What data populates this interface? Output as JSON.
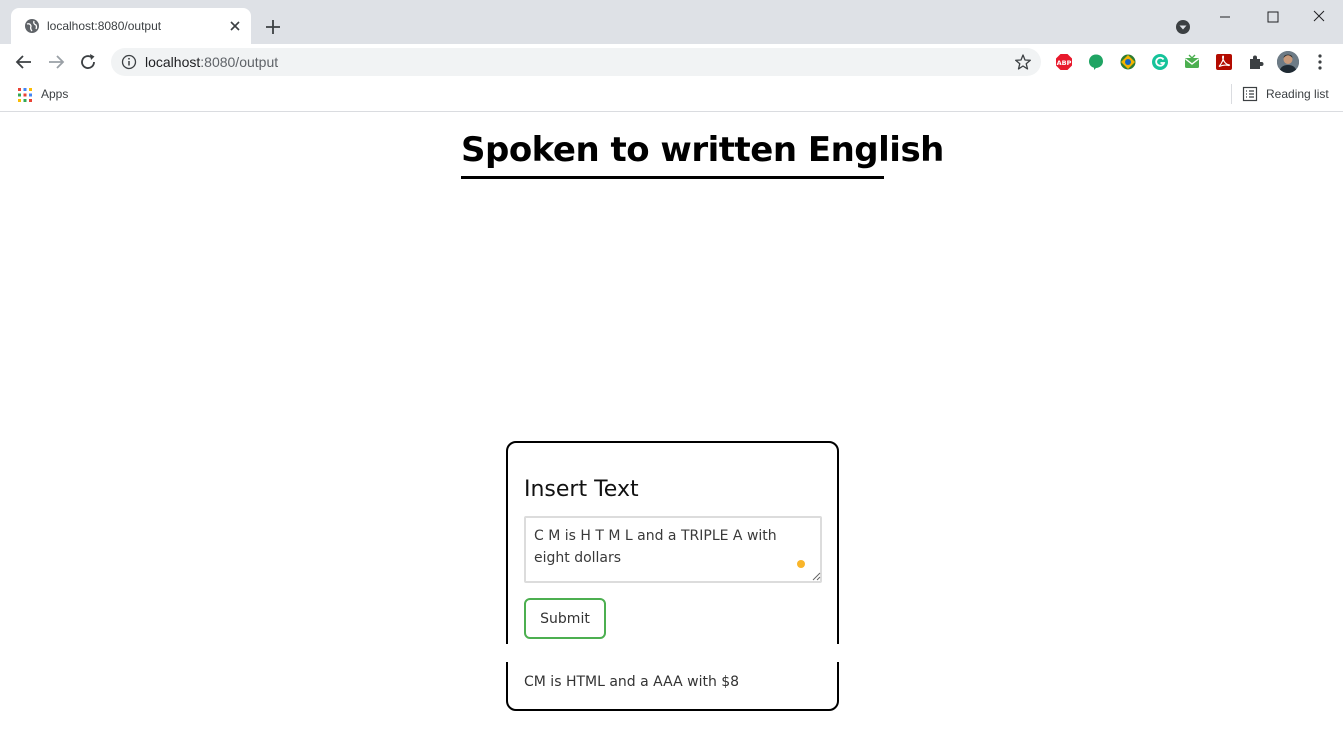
{
  "browser": {
    "tab_title": "localhost:8080/output",
    "url_host": "localhost",
    "url_path": ":8080/output",
    "bookmarks": {
      "apps_label": "Apps",
      "reading_list_label": "Reading list"
    },
    "extensions": [
      "adblock-plus-icon",
      "green-leaf-icon",
      "orb-extension-icon",
      "grammarly-icon",
      "mail-extension-icon",
      "acrobat-pdf-icon",
      "puzzle-icon"
    ]
  },
  "page": {
    "title": "Spoken to written English",
    "card": {
      "heading": "Insert Text",
      "input_value": "C M is H T M L and a TRIPLE A with eight dollars",
      "submit_label": "Submit",
      "output": "CM is HTML and a AAA with $8"
    }
  },
  "colors": {
    "submit_border": "#4caf50",
    "grammar_dot": "#f9b52a",
    "tabstrip": "#dee1e6"
  }
}
